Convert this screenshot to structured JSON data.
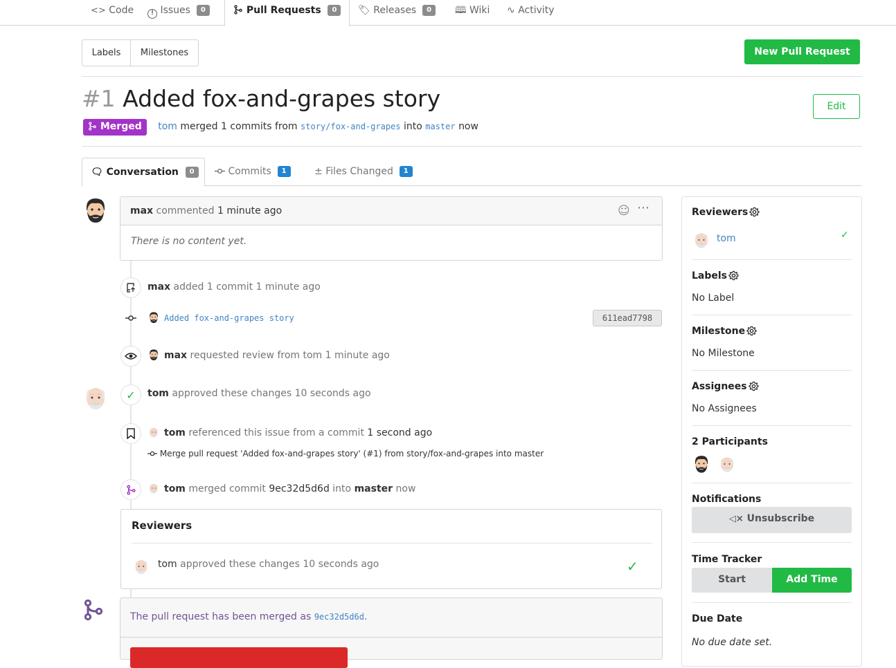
{
  "nav": {
    "code": "Code",
    "issues": "Issues",
    "issues_count": "0",
    "pulls": "Pull Requests",
    "pulls_count": "0",
    "releases": "Releases",
    "releases_count": "0",
    "wiki": "Wiki",
    "activity": "Activity"
  },
  "toolbar": {
    "labels": "Labels",
    "milestones": "Milestones",
    "new_pr": "New Pull Request"
  },
  "pr": {
    "number": "#1",
    "title": "Added fox-and-grapes story",
    "edit": "Edit",
    "status": "Merged",
    "author": "tom",
    "merged_text": "merged 1 commits from",
    "source_branch": "story/fox-and-grapes",
    "into": "into",
    "target_branch": "master",
    "when": "now"
  },
  "tabs": {
    "conversation": "Conversation",
    "conversation_count": "0",
    "commits": "Commits",
    "commits_count": "1",
    "files": "Files Changed",
    "files_count": "1"
  },
  "comment": {
    "user": "max",
    "action": "commented",
    "time": "1 minute ago",
    "body": "There is no content yet."
  },
  "timeline": {
    "added_user": "max",
    "added_text": "added",
    "added_count": "1 commit",
    "added_time": "1 minute ago",
    "commit_msg": "Added fox-and-grapes story",
    "commit_sha": "611ead7798",
    "review_req_user": "max",
    "review_req_text": "requested review from",
    "review_req_target": "tom",
    "review_req_time": "1 minute ago",
    "approved_user": "tom",
    "approved_text": "approved these changes",
    "approved_time": "10 seconds ago",
    "ref_user": "tom",
    "ref_text": "referenced this issue from a commit",
    "ref_time": "1 second ago",
    "ref_commit": "Merge pull request 'Added fox-and-grapes story' (#1) from story/fox-and-grapes into master",
    "merged_user": "tom",
    "merged_text": "merged commit",
    "merged_sha": "9ec32d5d6d",
    "merged_into": "into",
    "merged_branch": "master",
    "merged_time": "now"
  },
  "reviewers_box": {
    "title": "Reviewers",
    "user": "tom",
    "text": "approved these changes",
    "time": "10 seconds ago"
  },
  "merge_box": {
    "text": "The pull request has been merged as",
    "sha": "9ec32d5d6d",
    "period": "."
  },
  "sidebar": {
    "reviewers": "Reviewers",
    "reviewer": "tom",
    "labels": "Labels",
    "labels_value": "No Label",
    "milestone": "Milestone",
    "milestone_value": "No Milestone",
    "assignees": "Assignees",
    "assignees_value": "No Assignees",
    "participants": "2 Participants",
    "notifications": "Notifications",
    "unsubscribe": "Unsubscribe",
    "time_tracker": "Time Tracker",
    "start": "Start",
    "add_time": "Add Time",
    "due_date": "Due Date",
    "due_date_value": "No due date set."
  },
  "colors": {
    "green": "#21ba45",
    "purple": "#a333c8",
    "blue": "#2185d0",
    "link": "#4183c4"
  }
}
